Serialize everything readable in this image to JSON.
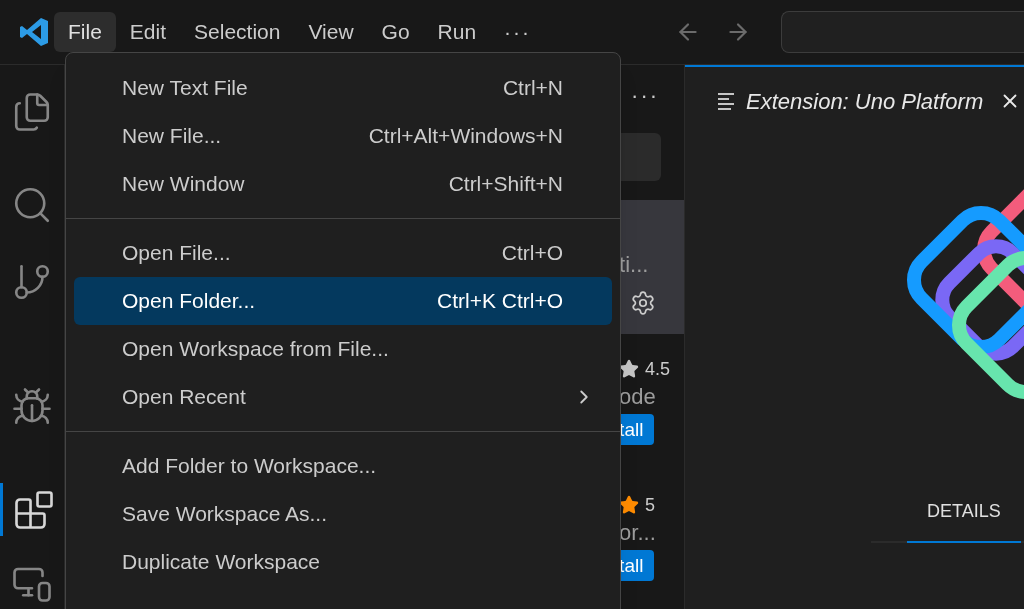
{
  "title_bar": {
    "menus": [
      {
        "label": "File",
        "selected": true
      },
      {
        "label": "Edit",
        "selected": false
      },
      {
        "label": "Selection",
        "selected": false
      },
      {
        "label": "View",
        "selected": false
      },
      {
        "label": "Go",
        "selected": false
      },
      {
        "label": "Run",
        "selected": false
      }
    ],
    "more": "···"
  },
  "activity_bar": [
    {
      "kind": "files",
      "selected": false
    },
    {
      "kind": "search",
      "selected": false
    },
    {
      "kind": "source-control",
      "selected": false
    },
    {
      "kind": "debug",
      "selected": false
    },
    {
      "kind": "extensions",
      "selected": true
    },
    {
      "kind": "remote",
      "selected": false
    }
  ],
  "file_menu": {
    "groups": [
      [
        {
          "label": "New Text File",
          "shortcut": "Ctrl+N",
          "selected": false,
          "submenu": false
        },
        {
          "label": "New File...",
          "shortcut": "Ctrl+Alt+Windows+N",
          "selected": false,
          "submenu": false
        },
        {
          "label": "New Window",
          "shortcut": "Ctrl+Shift+N",
          "selected": false,
          "submenu": false
        }
      ],
      [
        {
          "label": "Open File...",
          "shortcut": "Ctrl+O",
          "selected": false,
          "submenu": false
        },
        {
          "label": "Open Folder...",
          "shortcut": "Ctrl+K Ctrl+O",
          "selected": true,
          "submenu": false
        },
        {
          "label": "Open Workspace from File...",
          "selected": false,
          "submenu": false
        },
        {
          "label": "Open Recent",
          "selected": false,
          "submenu": true
        }
      ],
      [
        {
          "label": "Add Folder to Workspace...",
          "selected": false,
          "submenu": false
        },
        {
          "label": "Save Workspace As...",
          "selected": false,
          "submenu": false
        },
        {
          "label": "Duplicate Workspace",
          "selected": false,
          "submenu": false
        }
      ]
    ]
  },
  "sidebar": {
    "more": "···",
    "extensions": [
      {
        "selected": true,
        "name": "ti..."
      },
      {
        "selected": false,
        "rating": "4.5",
        "color": "#c5c5c5",
        "name": "ode",
        "install": "tall"
      },
      {
        "selected": false,
        "rating": "5",
        "color": "#ff8c00",
        "name": "or...",
        "install": "tall"
      }
    ]
  },
  "editor": {
    "tab": {
      "title": "Extension: Uno Platform"
    },
    "detail_tabs": [
      {
        "label": "DETAILS",
        "selected": true
      }
    ]
  }
}
